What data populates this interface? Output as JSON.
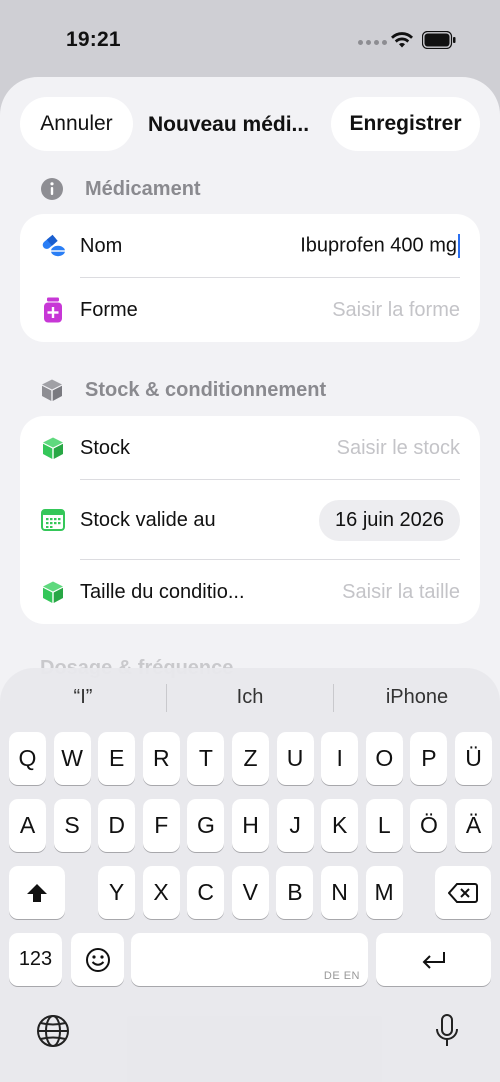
{
  "status_bar": {
    "time": "19:21"
  },
  "nav": {
    "cancel_label": "Annuler",
    "title": "Nouveau médi...",
    "save_label": "Enregistrer"
  },
  "sections": {
    "medicament": {
      "header": "Médicament",
      "rows": {
        "name": {
          "label": "Nom",
          "value": "Ibuprofen 400 mg"
        },
        "form": {
          "label": "Forme",
          "placeholder": "Saisir la forme"
        }
      }
    },
    "stock": {
      "header": "Stock & conditionnement",
      "rows": {
        "stock": {
          "label": "Stock",
          "placeholder": "Saisir le stock"
        },
        "valid_until": {
          "label": "Stock valide au",
          "value": "16 juin 2026"
        },
        "pack_size": {
          "label": "Taille du conditio...",
          "placeholder": "Saisir la taille"
        }
      }
    },
    "dosage_partial": "Dosage & fréquence"
  },
  "keyboard": {
    "suggestions": [
      "“I”",
      "Ich",
      "iPhone"
    ],
    "row1": [
      "Q",
      "W",
      "E",
      "R",
      "T",
      "Z",
      "U",
      "I",
      "O",
      "P",
      "Ü"
    ],
    "row2": [
      "A",
      "S",
      "D",
      "F",
      "G",
      "H",
      "J",
      "K",
      "L",
      "Ö",
      "Ä"
    ],
    "row3": [
      "Y",
      "X",
      "C",
      "V",
      "B",
      "N",
      "M"
    ],
    "numbers_label": "123",
    "space_sublabel": "DE EN"
  },
  "colors": {
    "accent_blue": "#2a6ff0",
    "form_icon": "#c737d6",
    "stock_icon": "#34c759",
    "placeholder": "#c4c4c8"
  }
}
